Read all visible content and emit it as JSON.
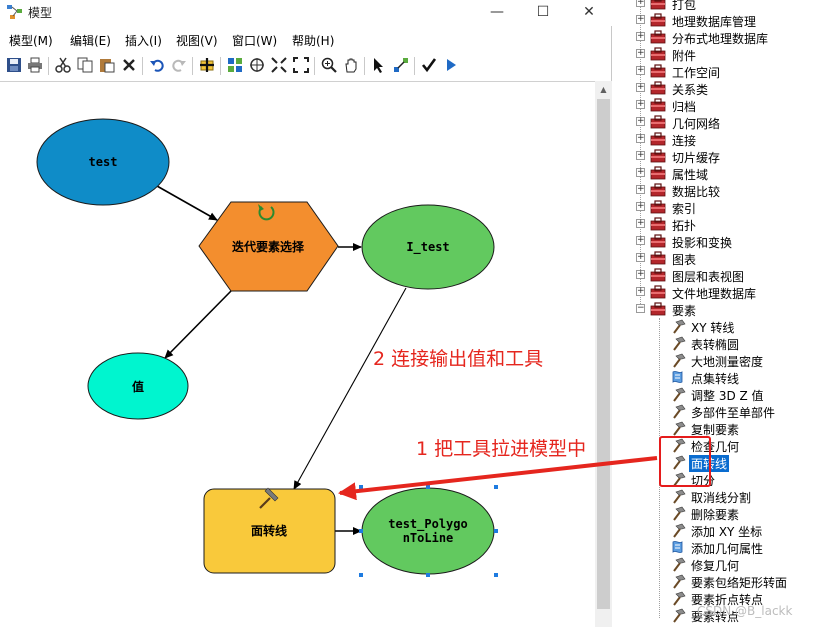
{
  "window": {
    "title": "模型",
    "controls": {
      "minimize": "—",
      "maximize": "☐",
      "close": "✕"
    }
  },
  "menubar": {
    "items": [
      "模型(M)",
      "编辑(E)",
      "插入(I)",
      "视图(V)",
      "窗口(W)",
      "帮助(H)"
    ]
  },
  "toolbar": {
    "icons": [
      "save-icon",
      "print-icon",
      "cut-icon",
      "copy-icon",
      "paste-icon",
      "delete-icon",
      "undo-icon",
      "redo-icon",
      "add-data-icon",
      "auto-layout-icon",
      "full-extent-icon",
      "zoom-fit-icon",
      "fixed-zoom-icon",
      "zoom-in-icon",
      "pan-icon",
      "select-icon",
      "connect-icon",
      "validate-icon",
      "run-icon"
    ]
  },
  "model": {
    "nodes": {
      "test": {
        "label": "test",
        "color": "#0f8cc8"
      },
      "iterator": {
        "label": "迭代要素选择",
        "color": "#f38e2e"
      },
      "i_test": {
        "label": "I_test",
        "color": "#62c95f"
      },
      "value": {
        "label": "值",
        "color": "#00f5cf"
      },
      "tool": {
        "label": "面转线",
        "color": "#f9c93b"
      },
      "output_line1": "test_Polygo",
      "output_line2": "nToLine",
      "output_color": "#62c95f"
    }
  },
  "toolbox": {
    "toolsets": [
      {
        "label": "打包"
      },
      {
        "label": "地理数据库管理"
      },
      {
        "label": "分布式地理数据库"
      },
      {
        "label": "附件"
      },
      {
        "label": "工作空间"
      },
      {
        "label": "关系类"
      },
      {
        "label": "归档"
      },
      {
        "label": "几何网络"
      },
      {
        "label": "连接"
      },
      {
        "label": "切片缓存"
      },
      {
        "label": "属性域"
      },
      {
        "label": "数据比较"
      },
      {
        "label": "索引"
      },
      {
        "label": "拓扑"
      },
      {
        "label": "投影和变换"
      },
      {
        "label": "图表"
      },
      {
        "label": "图层和表视图"
      },
      {
        "label": "文件地理数据库"
      },
      {
        "label": "要素"
      }
    ],
    "tools": [
      {
        "label": "XY 转线",
        "icon": "hammer-icon"
      },
      {
        "label": "表转椭圆",
        "icon": "hammer-icon"
      },
      {
        "label": "大地测量密度",
        "icon": "hammer-icon"
      },
      {
        "label": "点集转线",
        "icon": "script-icon"
      },
      {
        "label": "调整 3D Z 值",
        "icon": "hammer-icon"
      },
      {
        "label": "多部件至单部件",
        "icon": "hammer-icon"
      },
      {
        "label": "复制要素",
        "icon": "hammer-icon"
      },
      {
        "label": "检查几何",
        "icon": "hammer-icon"
      },
      {
        "label": "面转线",
        "icon": "hammer-icon",
        "selected": true
      },
      {
        "label": "切分",
        "icon": "hammer-icon"
      },
      {
        "label": "取消线分割",
        "icon": "hammer-icon"
      },
      {
        "label": "删除要素",
        "icon": "hammer-icon"
      },
      {
        "label": "添加 XY 坐标",
        "icon": "hammer-icon"
      },
      {
        "label": "添加几何属性",
        "icon": "script-icon"
      },
      {
        "label": "修复几何",
        "icon": "hammer-icon"
      },
      {
        "label": "要素包络矩形转面",
        "icon": "hammer-icon"
      },
      {
        "label": "要素折点转点",
        "icon": "hammer-icon"
      },
      {
        "label": "要素转点",
        "icon": "hammer-icon"
      }
    ]
  },
  "annotations": {
    "step1": "1 把工具拉进模型中",
    "step2": "2 连接输出值和工具",
    "color": "#e5261e"
  },
  "watermark": "CSDN @B_lackk"
}
